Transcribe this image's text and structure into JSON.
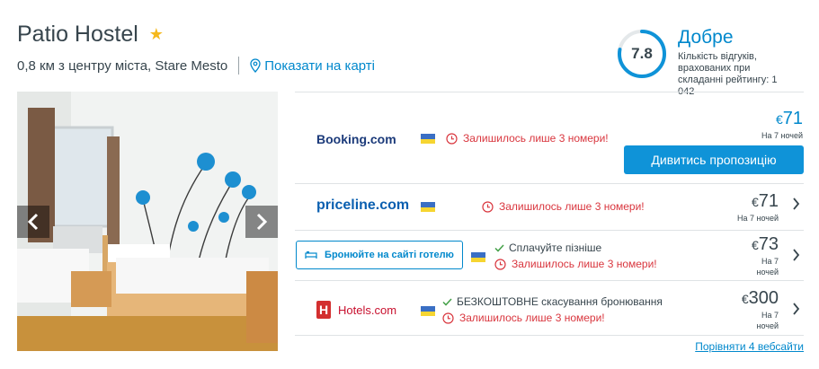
{
  "hotel": {
    "name": "Patio Hostel",
    "star_icon": "star-icon",
    "distance": "0,8 км з центру міста, Stare Mesto",
    "map_link": "Показати на карті"
  },
  "rating": {
    "score": "7.8",
    "word": "Добре",
    "description": "Кількість відгуків, врахованих при складанні рейтингу: 1 042",
    "score_fraction": 0.78
  },
  "photo": {
    "prev_icon": "chevron-left-icon",
    "next_icon": "chevron-right-icon"
  },
  "offers": [
    {
      "partner": "Booking.com",
      "urgency": "Залишилось лише 3 номери!",
      "currency": "€",
      "price": "71",
      "nights": "На 7 ночей",
      "cta": "Дивитись пропозицію"
    },
    {
      "partner": "priceline.com",
      "urgency": "Залишилось лише 3 номери!",
      "currency": "€",
      "price": "71",
      "nights": "На 7 ночей"
    },
    {
      "partner_button": "Бронюйте на сайті готелю",
      "perk": "Сплачуйте пізніше",
      "urgency": "Залишилось лише 3 номери!",
      "currency": "€",
      "price": "73",
      "nights_line1": "На 7",
      "nights_line2": "ночей"
    },
    {
      "partner": "Hotels.com",
      "perk": "БЕЗКОШТОВНЕ скасування бронювання",
      "urgency": "Залишилось лише 3 номери!",
      "currency": "€",
      "price": "300",
      "nights_line1": "На 7",
      "nights_line2": "ночей"
    }
  ],
  "compare_link": "Порівняти 4 вебсайти",
  "colors": {
    "accent": "#0088cc",
    "cta": "#0f93d8",
    "urgency": "#d9363e",
    "star": "#f5b81c",
    "perk_check": "#43a047"
  }
}
